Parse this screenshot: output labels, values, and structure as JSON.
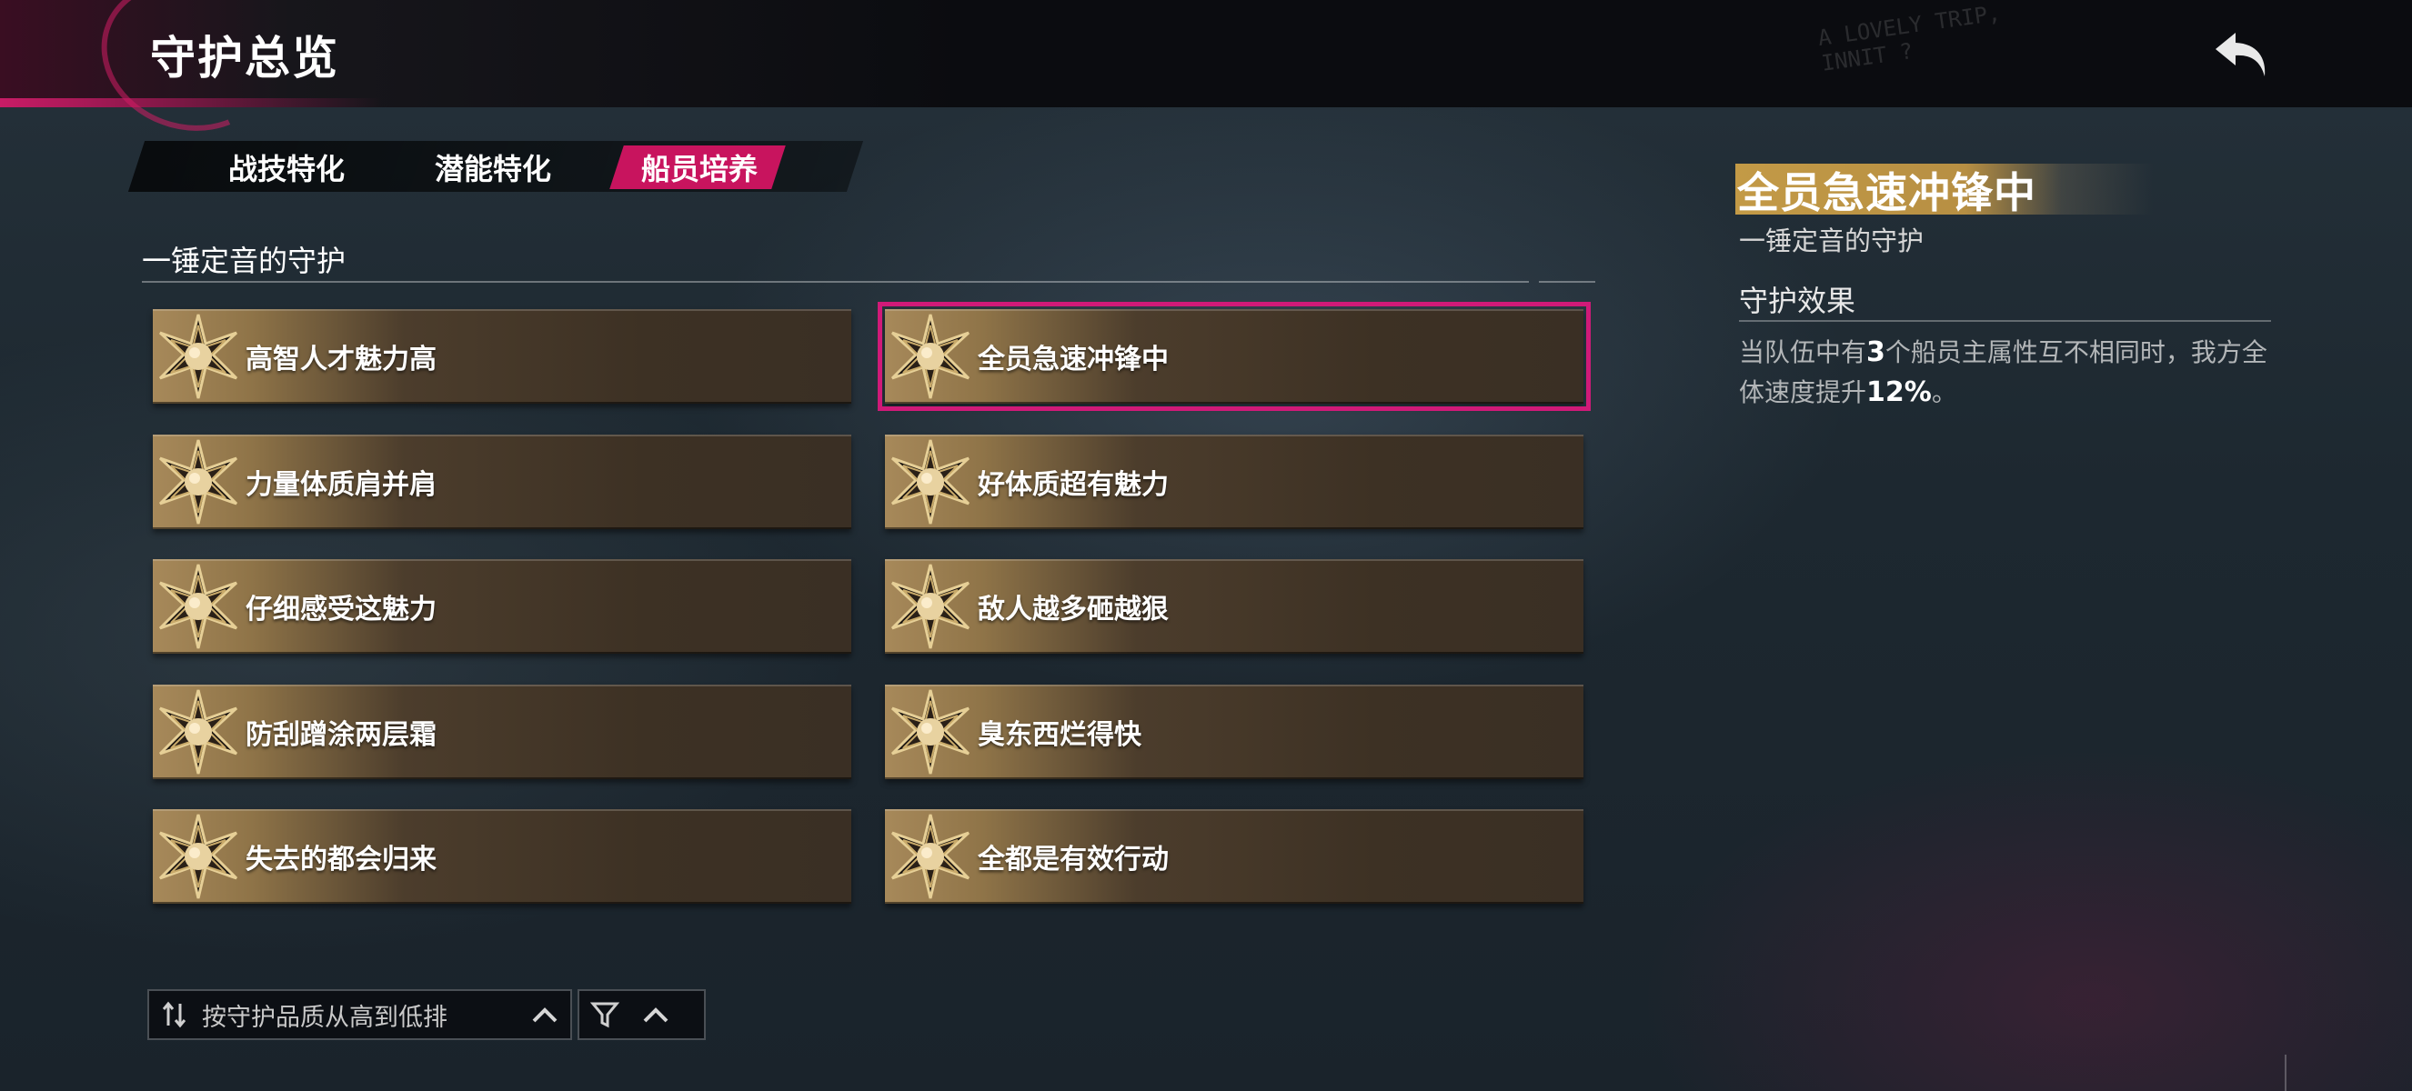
{
  "header": {
    "title": "守护总览",
    "back_label": "返回"
  },
  "tabs": [
    {
      "label": "战技特化",
      "active": false
    },
    {
      "label": "潜能特化",
      "active": false
    },
    {
      "label": "船员培养",
      "active": true
    }
  ],
  "section": {
    "title": "一锤定音的守护"
  },
  "cards": [
    {
      "label": "高智人才魅力高",
      "selected": false
    },
    {
      "label": "全员急速冲锋中",
      "selected": true
    },
    {
      "label": "力量体质肩并肩",
      "selected": false
    },
    {
      "label": "好体质超有魅力",
      "selected": false
    },
    {
      "label": "仔细感受这魅力",
      "selected": false
    },
    {
      "label": "敌人越多砸越狠",
      "selected": false
    },
    {
      "label": "防刮蹭涂两层霜",
      "selected": false
    },
    {
      "label": "臭东西烂得快",
      "selected": false
    },
    {
      "label": "失去的都会归来",
      "selected": false
    },
    {
      "label": "全都是有效行动",
      "selected": false
    }
  ],
  "sort": {
    "label": "按守护品质从高到低排"
  },
  "detail": {
    "title": "全员急速冲锋中",
    "subtitle": "一锤定音的守护",
    "effect_title": "守护效果",
    "effect_text_1": "当队伍中有",
    "effect_num_1": "3",
    "effect_text_2": "个船员主属性互不相同时，我方全体速度提升",
    "effect_num_2": "12%",
    "effect_text_3": "。"
  },
  "decor": {
    "sticker_line1": "A LOVELY TRIP,",
    "sticker_line2": "INNIT ?"
  },
  "colors": {
    "accent": "#c8145e",
    "card_gold": "#a7895a",
    "title_gold": "#c39a46"
  },
  "icons": [
    "back-arrow-icon",
    "star-emblem-icon",
    "sort-icon",
    "chevron-up-icon",
    "filter-icon"
  ]
}
